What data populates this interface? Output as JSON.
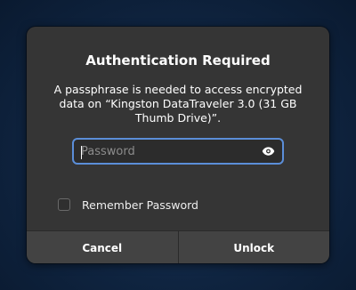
{
  "dialog": {
    "title": "Authentication Required",
    "message": "A passphrase is needed to access encrypted data on “Kingston DataTraveler 3.0 (31 GB Thumb Drive)”.",
    "password": {
      "placeholder": "Password",
      "value": "",
      "reveal_icon": "eye-icon"
    },
    "remember": {
      "label": "Remember Password",
      "checked": false
    },
    "buttons": {
      "cancel_label": "Cancel",
      "unlock_label": "Unlock"
    }
  },
  "colors": {
    "dialog_background": "#353535",
    "focus_accent": "#5b8ed8",
    "button_background": "#434343"
  }
}
